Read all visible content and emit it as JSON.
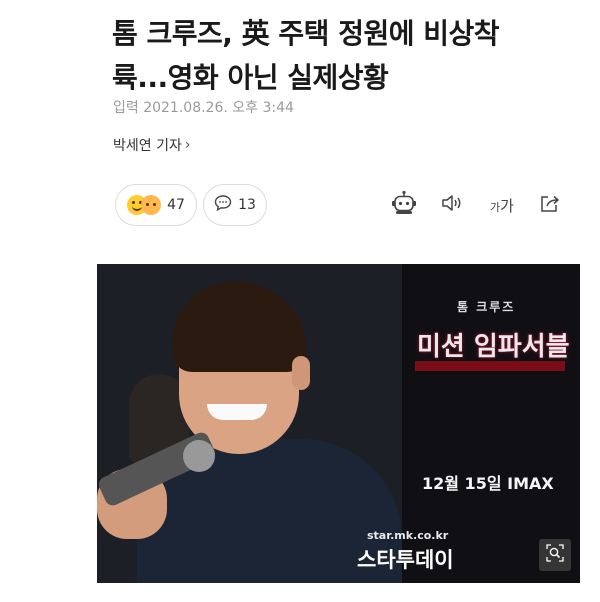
{
  "article": {
    "title_line1": "톰 크루즈, 英 주택 정원에 비상착",
    "title_line2": "륙...영화 아닌 실제상황",
    "meta": "입력 2021.08.26. 오후 3:44",
    "byline": "박세연 기자",
    "byline_chevron": "›"
  },
  "actions": {
    "reaction_count": "47",
    "comment_count": "13",
    "icons": [
      "robot-icon",
      "speaker-icon",
      "font-size-icon",
      "share-icon"
    ],
    "font_small": "가",
    "font_large": "가"
  },
  "photo": {
    "poster_subtitle": "톰 크루즈",
    "poster_title": "미션 임파서블",
    "poster_date": "12월 15일 IMAX",
    "watermark_url": "star.mk.co.kr",
    "watermark_brand": "스타투데이"
  }
}
